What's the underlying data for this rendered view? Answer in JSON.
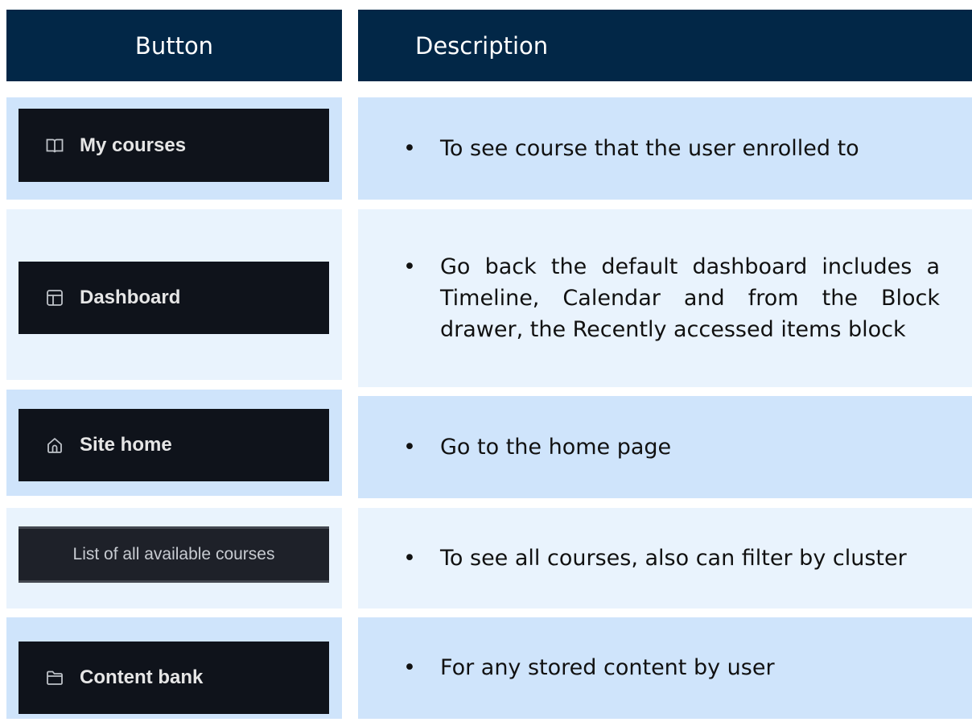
{
  "header": {
    "button_col": "Button",
    "description_col": "Description"
  },
  "rows": [
    {
      "button_label": "My courses",
      "icon": "book-icon",
      "bullet": "•",
      "description": "To see course that the user enrolled to"
    },
    {
      "button_label": "Dashboard",
      "icon": "dashboard-icon",
      "bullet": "•",
      "description": "Go back the default dashboard includes a Timeline, Calendar and from the Block drawer, the Recently accessed items block"
    },
    {
      "button_label": "Site home",
      "icon": "home-icon",
      "bullet": "•",
      "description": "Go to the home page"
    },
    {
      "button_label": "List of all available courses",
      "icon": "",
      "bullet": "•",
      "description": "To see all courses, also can filter by cluster"
    },
    {
      "button_label": "Content bank",
      "icon": "folder-icon",
      "bullet": "•",
      "description": "For any stored content by user"
    }
  ],
  "colors": {
    "header": "#022747",
    "row_light_blue": "#cfe4fb",
    "row_pale_blue": "#e9f3fd",
    "button_bg": "#0f131b"
  }
}
